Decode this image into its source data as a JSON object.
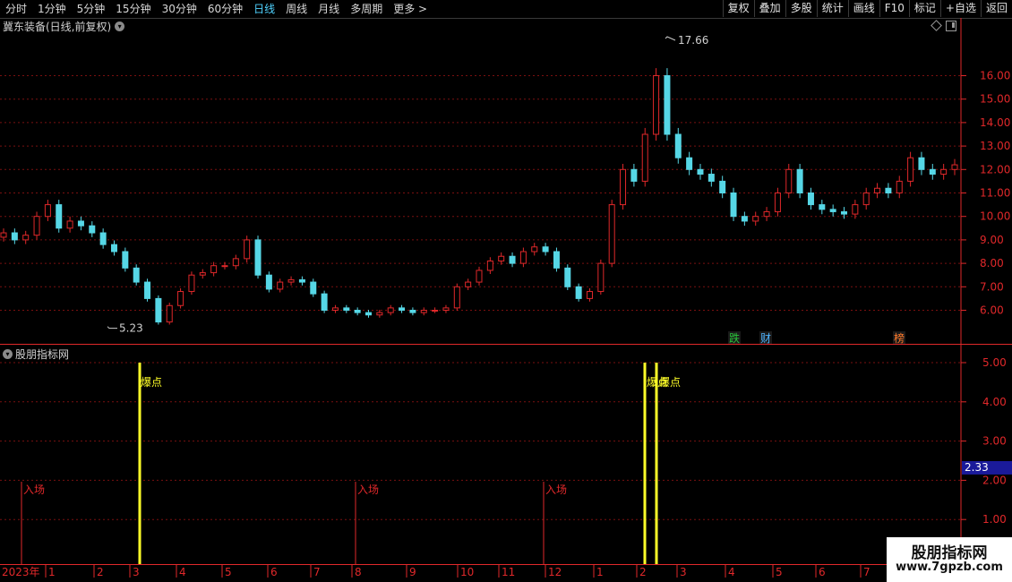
{
  "toolbar": {
    "periods": [
      "分时",
      "1分钟",
      "5分钟",
      "15分钟",
      "30分钟",
      "60分钟",
      "日线",
      "周线",
      "月线",
      "多周期",
      "更多 >"
    ],
    "active_period": "日线",
    "actions": [
      "复权",
      "叠加",
      "多股",
      "统计",
      "画线",
      "F10",
      "标记",
      "+自选",
      "返回"
    ]
  },
  "main_chart": {
    "title": "冀东装备(日线,前复权)",
    "high_label": "17.66",
    "low_label": "5.23",
    "y_ticks": [
      "16.00",
      "15.00",
      "14.00",
      "13.00",
      "12.00",
      "11.00",
      "10.00",
      "9.00",
      "8.00",
      "7.00",
      "6.00"
    ],
    "event_tags": [
      {
        "text": "跌",
        "color": "#29c43a"
      },
      {
        "text": "财",
        "color": "#4fb4ff"
      },
      {
        "text": "榜",
        "color": "#ff7a2a"
      }
    ]
  },
  "indicator": {
    "title": "股朋指标网",
    "y_ticks": [
      "5.00",
      "4.00",
      "3.00",
      "2.00",
      "1.00"
    ],
    "current_value": "2.33",
    "signal_labels": {
      "burst": "爆点",
      "entry": "入场"
    }
  },
  "time_axis": {
    "labels": [
      "2023年",
      "1",
      "2",
      "3",
      "4",
      "5",
      "6",
      "7",
      "8",
      "9",
      "10",
      "11",
      "12",
      "1",
      "2",
      "3",
      "4",
      "5",
      "6",
      "7"
    ]
  },
  "watermark": {
    "line1": "股朋指标网",
    "line2": "www.7gpzb.com"
  },
  "chart_data": {
    "type": "candlestick",
    "series": [
      {
        "values": [
          9.3,
          9.0,
          9.2,
          10.0,
          10.5,
          9.5,
          9.8,
          9.6,
          9.3,
          8.8,
          8.5,
          7.8,
          7.2,
          6.5,
          5.5,
          6.2,
          6.8,
          7.5,
          7.6,
          7.9,
          7.9,
          8.2,
          9.0,
          7.5,
          6.9,
          7.2,
          7.3,
          7.2,
          6.7,
          6.0,
          6.1,
          6.0,
          5.9,
          5.8,
          5.9,
          6.1,
          6.0,
          5.9,
          6.0,
          6.0,
          6.1,
          7.0,
          7.2,
          7.7,
          8.1,
          8.3,
          8.0,
          8.5,
          8.7,
          8.5,
          7.8,
          7.0,
          6.5,
          6.8,
          8.0,
          10.5,
          12.0,
          11.5,
          13.5,
          16.0,
          13.5,
          12.5,
          12.0,
          11.8,
          11.5,
          11.0,
          10.0,
          9.8,
          10.0,
          10.2,
          11.0,
          12.0,
          11.0,
          10.5,
          10.3,
          10.2,
          10.1,
          10.5,
          11.0,
          11.2,
          11.0,
          11.5,
          12.5,
          12.0,
          11.8,
          12.0,
          12.2
        ]
      }
    ],
    "high": 17.66,
    "low": 5.23,
    "indicator_series": {
      "burst_signals": [
        {
          "month": "3"
        },
        {
          "month": "2"
        },
        {
          "month": "2"
        }
      ],
      "entry_signals": [
        {
          "month": "1"
        },
        {
          "month": "8"
        },
        {
          "month": "12"
        }
      ],
      "ylim": [
        0,
        5.5
      ],
      "current": 2.33
    }
  }
}
